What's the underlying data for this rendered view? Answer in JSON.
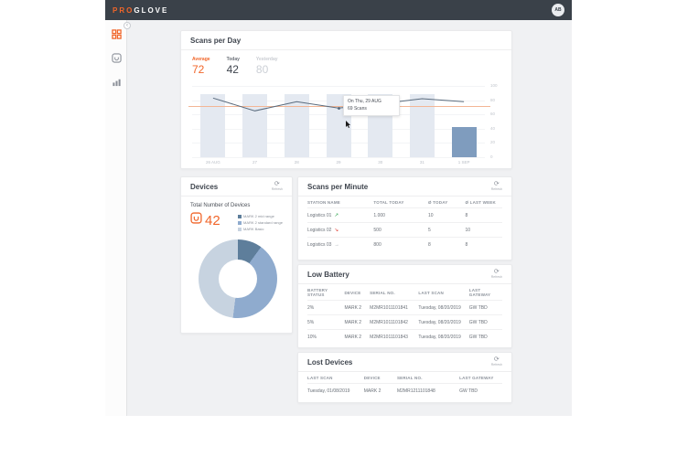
{
  "topbar": {
    "logo_pro": "PRO",
    "logo_glove": "GLOVE",
    "avatar_initials": "AB"
  },
  "sidebar": {
    "items": [
      {
        "icon": "dashboard-grid-icon",
        "active": true
      },
      {
        "icon": "scanner-device-icon",
        "active": false
      },
      {
        "icon": "analytics-bars-icon",
        "active": false
      }
    ]
  },
  "scans_per_day": {
    "title": "Scans per Day",
    "stats": [
      {
        "label": "Average",
        "value": "72"
      },
      {
        "label": "Today",
        "value": "42"
      },
      {
        "label": "Yesterday",
        "value": "80"
      }
    ],
    "tooltip": {
      "line1": "On Thu, 29 AUG",
      "line2": "69 Scans",
      "point_index": 3
    }
  },
  "chart_data": [
    {
      "type": "bar",
      "title": "Scans per Day",
      "categories": [
        "26 AUG",
        "27",
        "28",
        "29",
        "30",
        "31",
        "1 SEP"
      ],
      "series": [
        {
          "name": "day-columns",
          "type": "bar",
          "color": "#e4e9f1",
          "values": [
            88,
            88,
            88,
            88,
            88,
            88,
            0
          ]
        },
        {
          "name": "today",
          "type": "bar",
          "color": "#7f9cbe",
          "values": [
            0,
            0,
            0,
            0,
            0,
            0,
            42
          ]
        },
        {
          "name": "scans-line",
          "type": "line",
          "color": "#5a6b7d",
          "values": [
            83,
            65,
            78,
            69,
            75,
            82,
            78
          ]
        },
        {
          "name": "average-line",
          "type": "line",
          "color": "#f3b695",
          "values": [
            72,
            72,
            72,
            72,
            72,
            72,
            72
          ]
        }
      ],
      "ylim": [
        0,
        100
      ],
      "yticks": [
        100,
        80,
        60,
        40,
        20,
        0
      ],
      "legend": "none",
      "grid": true
    },
    {
      "type": "pie",
      "title": "Total Number of Devices",
      "labels": [
        "MARK 2 mid range",
        "MARK 2 standard range",
        "MARK Basic"
      ],
      "values": [
        10,
        42,
        48
      ],
      "colors": [
        "#5e7e9b",
        "#8fabce",
        "#c7d3e0"
      ],
      "total": "42"
    }
  ],
  "devices": {
    "title": "Devices",
    "refresh_label": "Refresh",
    "subtitle": "Total Number of Devices",
    "total": "42"
  },
  "scans_per_minute": {
    "title": "Scans per Minute",
    "refresh_label": "Refresh",
    "columns": [
      "STATION NAME",
      "TOTAL TODAY",
      "Ø TODAY",
      "Ø LAST WEEK"
    ],
    "rows": [
      {
        "station": "Logistics 01",
        "trend": "up",
        "cells": [
          "1.000",
          "10",
          "8"
        ]
      },
      {
        "station": "Logistics 02",
        "trend": "down",
        "cells": [
          "500",
          "5",
          "10"
        ]
      },
      {
        "station": "Logistics 03",
        "trend": "flat",
        "cells": [
          "800",
          "8",
          "8"
        ]
      }
    ]
  },
  "low_battery": {
    "title": "Low Battery",
    "refresh_label": "Refresh",
    "columns": [
      "BATTERY STATUS",
      "DEVICE",
      "SERIAL NO.",
      "LAST SCAN",
      "LAST GATEWAY"
    ],
    "rows": [
      [
        "2%",
        "MARK 2",
        "M2MR1011101841",
        "Tuesday, 08/20/2019",
        "GW TBD"
      ],
      [
        "5%",
        "MARK 2",
        "M2MR1011101842",
        "Tuesday, 08/20/2019",
        "GW TBD"
      ],
      [
        "10%",
        "MARK 2",
        "M2MR1011101843",
        "Tuesday, 08/20/2019",
        "GW TBD"
      ]
    ]
  },
  "lost_devices": {
    "title": "Lost Devices",
    "refresh_label": "Refresh",
    "columns": [
      "LAST SCAN",
      "DEVICE",
      "SERIAL NO.",
      "LAST GATEWAY"
    ],
    "rows": [
      [
        "Tuesday, 01/08/2019",
        "MARK 2",
        "M2MR1211101848",
        "GW TBD"
      ]
    ]
  }
}
